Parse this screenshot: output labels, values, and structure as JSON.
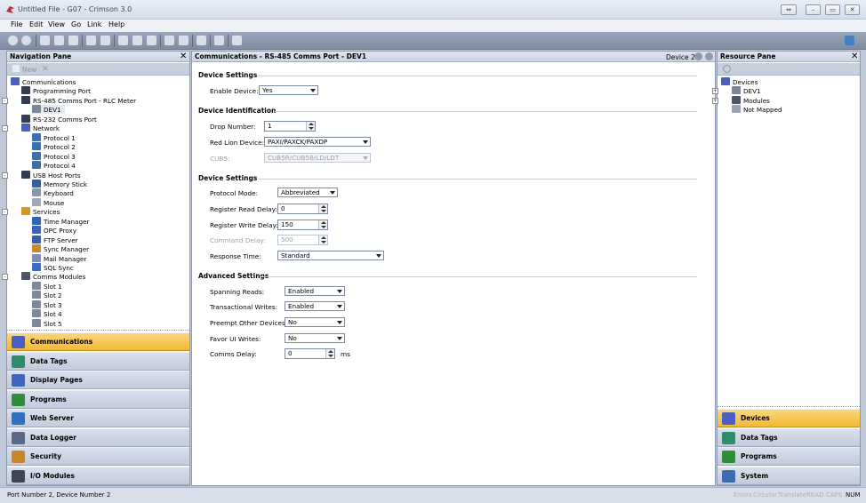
{
  "window": {
    "title": "Untitled File - G07 - Crimson 3.0",
    "buttons": [
      "⇔",
      "–",
      "▭",
      "✕"
    ]
  },
  "menu": [
    {
      "label": "File",
      "key": "F"
    },
    {
      "label": "Edit",
      "key": "E"
    },
    {
      "label": "View",
      "key": "V"
    },
    {
      "label": "Go",
      "key": "G"
    },
    {
      "label": "Link",
      "key": "L"
    },
    {
      "label": "Help",
      "key": "H"
    }
  ],
  "nav_pane": {
    "title": "Navigation Pane",
    "new_label": "New",
    "tree": [
      {
        "label": "Communications",
        "icon": "communications-icon",
        "level": 0,
        "expander": ""
      },
      {
        "label": "Programming Port",
        "icon": "port-icon",
        "level": 1,
        "expander": ""
      },
      {
        "label": "RS-485 Comms Port - RLC Meter",
        "icon": "port-icon",
        "level": 1,
        "expander": "-"
      },
      {
        "label": "DEV1",
        "icon": "device-icon",
        "level": 2,
        "expander": "",
        "selected": true
      },
      {
        "label": "RS-232 Comms Port",
        "icon": "port-icon",
        "level": 1,
        "expander": ""
      },
      {
        "label": "Network",
        "icon": "network-icon",
        "level": 1,
        "expander": "-"
      },
      {
        "label": "Protocol 1",
        "icon": "protocol-icon",
        "level": 2,
        "expander": ""
      },
      {
        "label": "Protocol 2",
        "icon": "protocol-icon",
        "level": 2,
        "expander": ""
      },
      {
        "label": "Protocol 3",
        "icon": "protocol-icon",
        "level": 2,
        "expander": ""
      },
      {
        "label": "Protocol 4",
        "icon": "protocol-icon",
        "level": 2,
        "expander": ""
      },
      {
        "label": "USB Host Ports",
        "icon": "usb-icon",
        "level": 1,
        "expander": "-"
      },
      {
        "label": "Memory Stick",
        "icon": "memory-stick-icon",
        "level": 2,
        "expander": ""
      },
      {
        "label": "Keyboard",
        "icon": "keyboard-icon",
        "level": 2,
        "expander": ""
      },
      {
        "label": "Mouse",
        "icon": "mouse-icon",
        "level": 2,
        "expander": ""
      },
      {
        "label": "Services",
        "icon": "services-icon",
        "level": 1,
        "expander": "-"
      },
      {
        "label": "Time Manager",
        "icon": "time-manager-icon",
        "level": 2,
        "expander": ""
      },
      {
        "label": "OPC Proxy",
        "icon": "opc-proxy-icon",
        "level": 2,
        "expander": ""
      },
      {
        "label": "FTP Server",
        "icon": "ftp-server-icon",
        "level": 2,
        "expander": ""
      },
      {
        "label": "Sync Manager",
        "icon": "sync-manager-icon",
        "level": 2,
        "expander": ""
      },
      {
        "label": "Mail Manager",
        "icon": "mail-manager-icon",
        "level": 2,
        "expander": ""
      },
      {
        "label": "SQL Sync",
        "icon": "sql-sync-icon",
        "level": 2,
        "expander": ""
      },
      {
        "label": "Comms Modules",
        "icon": "comms-modules-icon",
        "level": 1,
        "expander": "-"
      },
      {
        "label": "Slot 1",
        "icon": "slot-icon",
        "level": 2,
        "expander": ""
      },
      {
        "label": "Slot 2",
        "icon": "slot-icon",
        "level": 2,
        "expander": ""
      },
      {
        "label": "Slot 3",
        "icon": "slot-icon",
        "level": 2,
        "expander": ""
      },
      {
        "label": "Slot 4",
        "icon": "slot-icon",
        "level": 2,
        "expander": ""
      },
      {
        "label": "Slot 5",
        "icon": "slot-icon",
        "level": 2,
        "expander": ""
      }
    ],
    "categories": [
      {
        "label": "Communications",
        "icon": "communications-icon",
        "active": true
      },
      {
        "label": "Data Tags",
        "icon": "data-tags-icon",
        "active": false
      },
      {
        "label": "Display Pages",
        "icon": "display-pages-icon",
        "active": false
      },
      {
        "label": "Programs",
        "icon": "programs-icon",
        "active": false
      },
      {
        "label": "Web Server",
        "icon": "web-server-icon",
        "active": false
      },
      {
        "label": "Data Logger",
        "icon": "data-logger-icon",
        "active": false
      },
      {
        "label": "Security",
        "icon": "security-icon",
        "active": false
      },
      {
        "label": "I/O Modules",
        "icon": "io-modules-icon",
        "active": false
      }
    ]
  },
  "editor": {
    "title": "Communications - RS-485 Comms Port - DEV1",
    "device_label": "Device 2",
    "sections": {
      "device_settings_1": "Device Settings",
      "device_identification": "Device Identification",
      "device_settings_2": "Device Settings",
      "advanced_settings": "Advanced Settings"
    },
    "fields": {
      "enable_device": {
        "label": "Enable Device:",
        "value": "Yes"
      },
      "drop_number": {
        "label": "Drop Number:",
        "value": "1"
      },
      "red_lion_device": {
        "label": "Red Lion Device:",
        "value": "PAXI/PAXCK/PAXDP"
      },
      "cub5": {
        "label": "CUB5:",
        "value": "CUB5R/CUB5B/LD/LDT"
      },
      "protocol_mode": {
        "label": "Protocol Mode:",
        "value": "Abbreviated"
      },
      "register_read_delay": {
        "label": "Register Read Delay:",
        "value": "0"
      },
      "register_write_delay": {
        "label": "Register Write Delay:",
        "value": "150"
      },
      "command_delay": {
        "label": "Command Delay:",
        "value": "500"
      },
      "response_time": {
        "label": "Response Time:",
        "value": "Standard"
      },
      "spanning_reads": {
        "label": "Spanning Reads:",
        "value": "Enabled"
      },
      "transactional_writes": {
        "label": "Transactional Writes:",
        "value": "Enabled"
      },
      "preempt_other_devices": {
        "label": "Preempt Other Devices:",
        "value": "No"
      },
      "favor_ui_writes": {
        "label": "Favor UI Writes:",
        "value": "No"
      },
      "comms_delay": {
        "label": "Comms Delay:",
        "value": "0",
        "unit": "ms"
      }
    }
  },
  "resource_pane": {
    "title": "Resource Pane",
    "tree": [
      {
        "label": "Devices",
        "icon": "devices-icon",
        "level": 0,
        "expander": ""
      },
      {
        "label": "DEV1",
        "icon": "device-icon",
        "level": 1,
        "expander": "+"
      },
      {
        "label": "Modules",
        "icon": "modules-icon",
        "level": 1,
        "expander": "+"
      },
      {
        "label": "Not Mapped",
        "icon": "not-mapped-icon",
        "level": 1,
        "expander": ""
      }
    ],
    "categories": [
      {
        "label": "Devices",
        "icon": "devices-icon",
        "active": true
      },
      {
        "label": "Data Tags",
        "icon": "data-tags-icon",
        "active": false
      },
      {
        "label": "Programs",
        "icon": "programs-icon",
        "active": false
      },
      {
        "label": "System",
        "icon": "system-icon",
        "active": false
      }
    ]
  },
  "status": {
    "text": "Port Number 2, Device Number 2",
    "indicators": [
      {
        "label": "Errors",
        "on": false
      },
      {
        "label": "Circular",
        "on": false
      },
      {
        "label": "Translate",
        "on": false
      },
      {
        "label": "READ",
        "on": false
      },
      {
        "label": "CAPS",
        "on": false
      },
      {
        "label": "NUM",
        "on": true
      }
    ]
  },
  "colors": {
    "active_category": "#f2b935",
    "pane_header": "#c9d3e3",
    "toolbar": "#7f8ca0"
  }
}
